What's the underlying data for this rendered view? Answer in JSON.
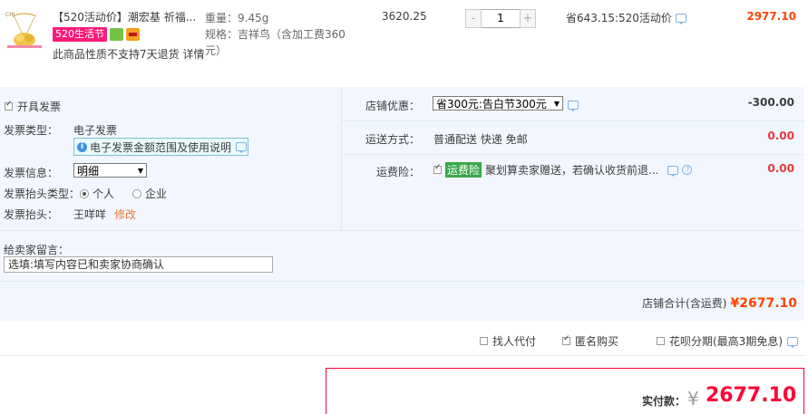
{
  "product": {
    "title": "【520活动价】潮宏基 祈福...",
    "tag_520": "520生活节",
    "no_return": "此商品性质不支持7天退货 详情",
    "spec": {
      "weight_label": "重量：",
      "weight_value": "9.45g",
      "style_label": "规格：",
      "style_value_1": "吉祥鸟（含加工费360",
      "style_value_2": "元）"
    },
    "unit_price": "3620.25",
    "qty_minus": "-",
    "quantity": "1",
    "qty_plus": "+",
    "saving": "省643.15:520活动价",
    "subtotal": "2977.10"
  },
  "invoice": {
    "open_label": "开具发票",
    "open_checked": true,
    "type_label": "发票类型：",
    "type_value": "电子发票",
    "tip_icon": "i",
    "tip_text": "电子发票金额范围及使用说明",
    "info_label": "发票信息：",
    "info_value": "明细",
    "header_type_label": "发票抬头类型：",
    "header_type_personal": "个人",
    "header_type_company": "企业",
    "header_label": "发票抬头：",
    "header_value": "王咩咩",
    "edit_label": "修改"
  },
  "message": {
    "label": "给卖家留言：",
    "placeholder": "选填:填写内容已和卖家协商确认"
  },
  "store": {
    "discount_label": "店铺优惠：",
    "discount_option": "省300元:告白节300元",
    "discount_amount": "-300.00",
    "shipping_label": "运送方式：",
    "shipping_value": "普通配送 快递 免邮",
    "shipping_amount": "0.00",
    "insurance_label": "运费险：",
    "insurance_tag": "运费险",
    "insurance_text": "聚划算卖家赠送，若确认收货前退...",
    "insurance_amount": "0.00",
    "total_label": "店铺合计(含运费)",
    "total_value": "¥2677.10"
  },
  "options": {
    "proxy_pay": "找人代付",
    "anonymous": "匿名购买",
    "huabei": "花呗分期(最高3期免息)"
  },
  "payment": {
    "label": "实付款：",
    "yen": "¥",
    "amount": "2677.10"
  },
  "colors": {
    "accent": "#ff0036",
    "orange": "#ff4400",
    "panel_bg": "#f2f7ff"
  }
}
